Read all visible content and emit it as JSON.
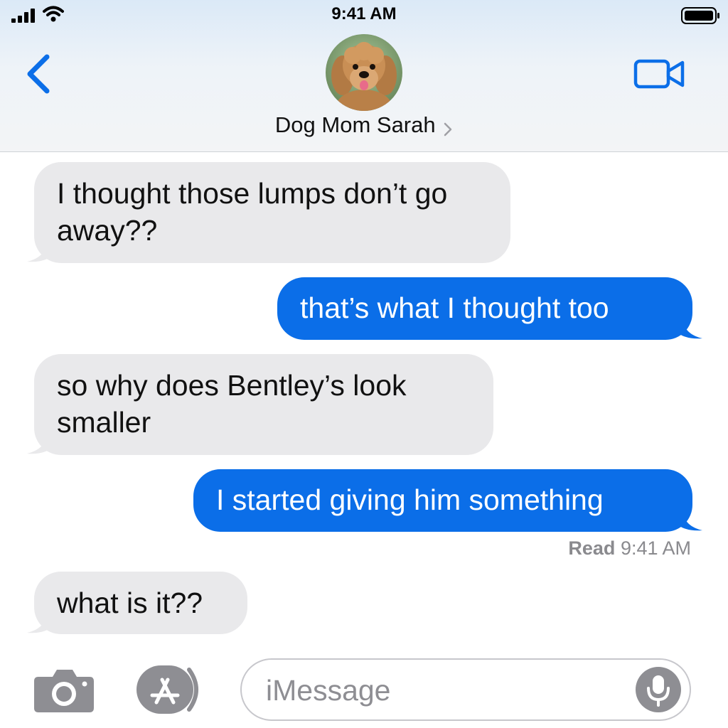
{
  "status_bar": {
    "time": "9:41 AM",
    "signal_icon": "signal-bars-icon",
    "wifi_icon": "wifi-icon",
    "battery_icon": "battery-icon"
  },
  "header": {
    "back_icon": "chevron-left-icon",
    "contact_name": "Dog Mom Sarah",
    "contact_chevron_icon": "chevron-right-icon",
    "avatar_icon": "dog-avatar-icon",
    "video_icon": "video-camera-icon"
  },
  "messages": [
    {
      "direction": "incoming",
      "text": "I thought those lumps don’t go away??"
    },
    {
      "direction": "outgoing",
      "text": "that’s what I thought too"
    },
    {
      "direction": "incoming",
      "text": "so why does Bentley’s look smaller"
    },
    {
      "direction": "outgoing",
      "text": "I started giving him something"
    },
    {
      "direction": "incoming",
      "text": "what is it??"
    }
  ],
  "read_receipt": {
    "label": "Read",
    "time": "9:41 AM"
  },
  "input_bar": {
    "camera_icon": "camera-icon",
    "apps_icon": "app-store-icon",
    "placeholder": "iMessage",
    "mic_icon": "microphone-icon"
  },
  "colors": {
    "accent": "#0b6ee8",
    "incoming_bubble": "#e9e9eb",
    "icon_gray": "#8e8e93"
  }
}
